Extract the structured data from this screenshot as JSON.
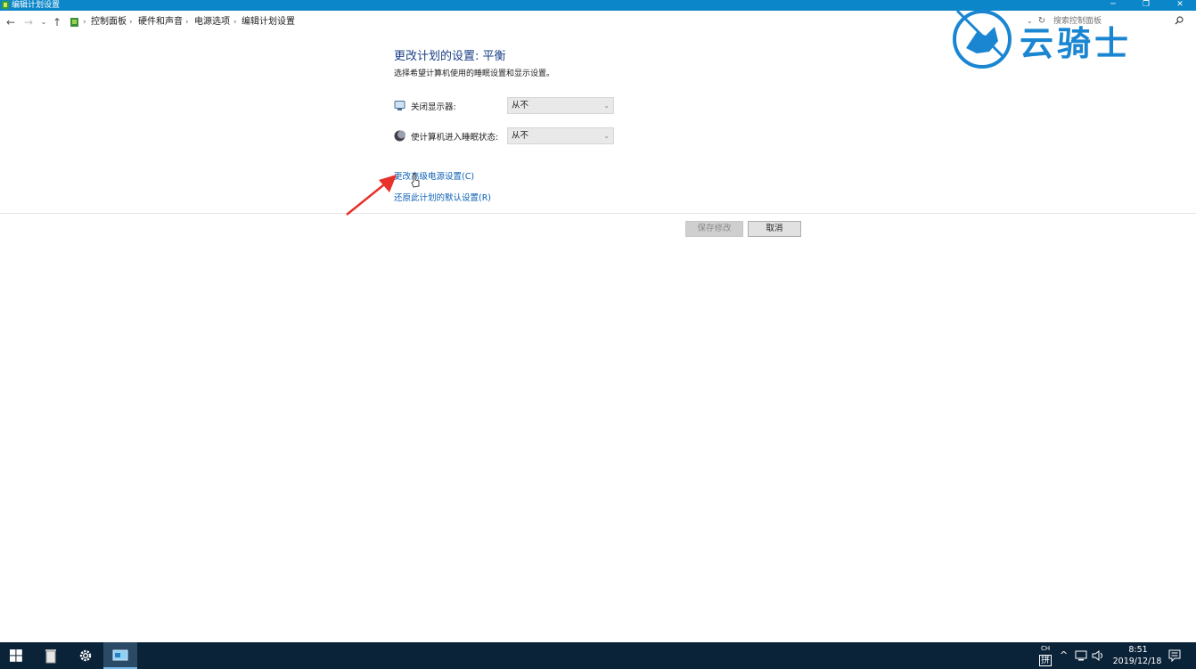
{
  "window": {
    "title": "编辑计划设置",
    "controls": {
      "minimize": "─",
      "restore": "❐",
      "close": "✕"
    }
  },
  "address_bar": {
    "breadcrumbs": [
      "控制面板",
      "硬件和声音",
      "电源选项",
      "编辑计划设置"
    ],
    "separator": "›",
    "search_placeholder": "搜索控制面板"
  },
  "main": {
    "heading": "更改计划的设置: 平衡",
    "subheading": "选择希望计算机使用的睡眠设置和显示设置。",
    "settings": [
      {
        "label": "关闭显示器:",
        "value": "从不",
        "icon": "monitor-icon"
      },
      {
        "label": "使计算机进入睡眠状态:",
        "value": "从不",
        "icon": "moon-icon"
      }
    ],
    "links": {
      "advanced": "更改高级电源设置(C)",
      "restore": "还原此计划的默认设置(R)"
    },
    "buttons": {
      "save": "保存修改",
      "cancel": "取消"
    }
  },
  "watermark": {
    "text": "云骑士"
  },
  "taskbar": {
    "tray_lang_top": "CH",
    "tray_lang_bottom": "拼",
    "time": "8:51",
    "date": "2019/12/18"
  },
  "colors": {
    "title_bar": "#0b86c9",
    "heading": "#1b3f86",
    "link": "#0c60b5",
    "taskbar": "#0b2339",
    "arrow": "#e8312a",
    "watermark": "#1a86d2"
  }
}
